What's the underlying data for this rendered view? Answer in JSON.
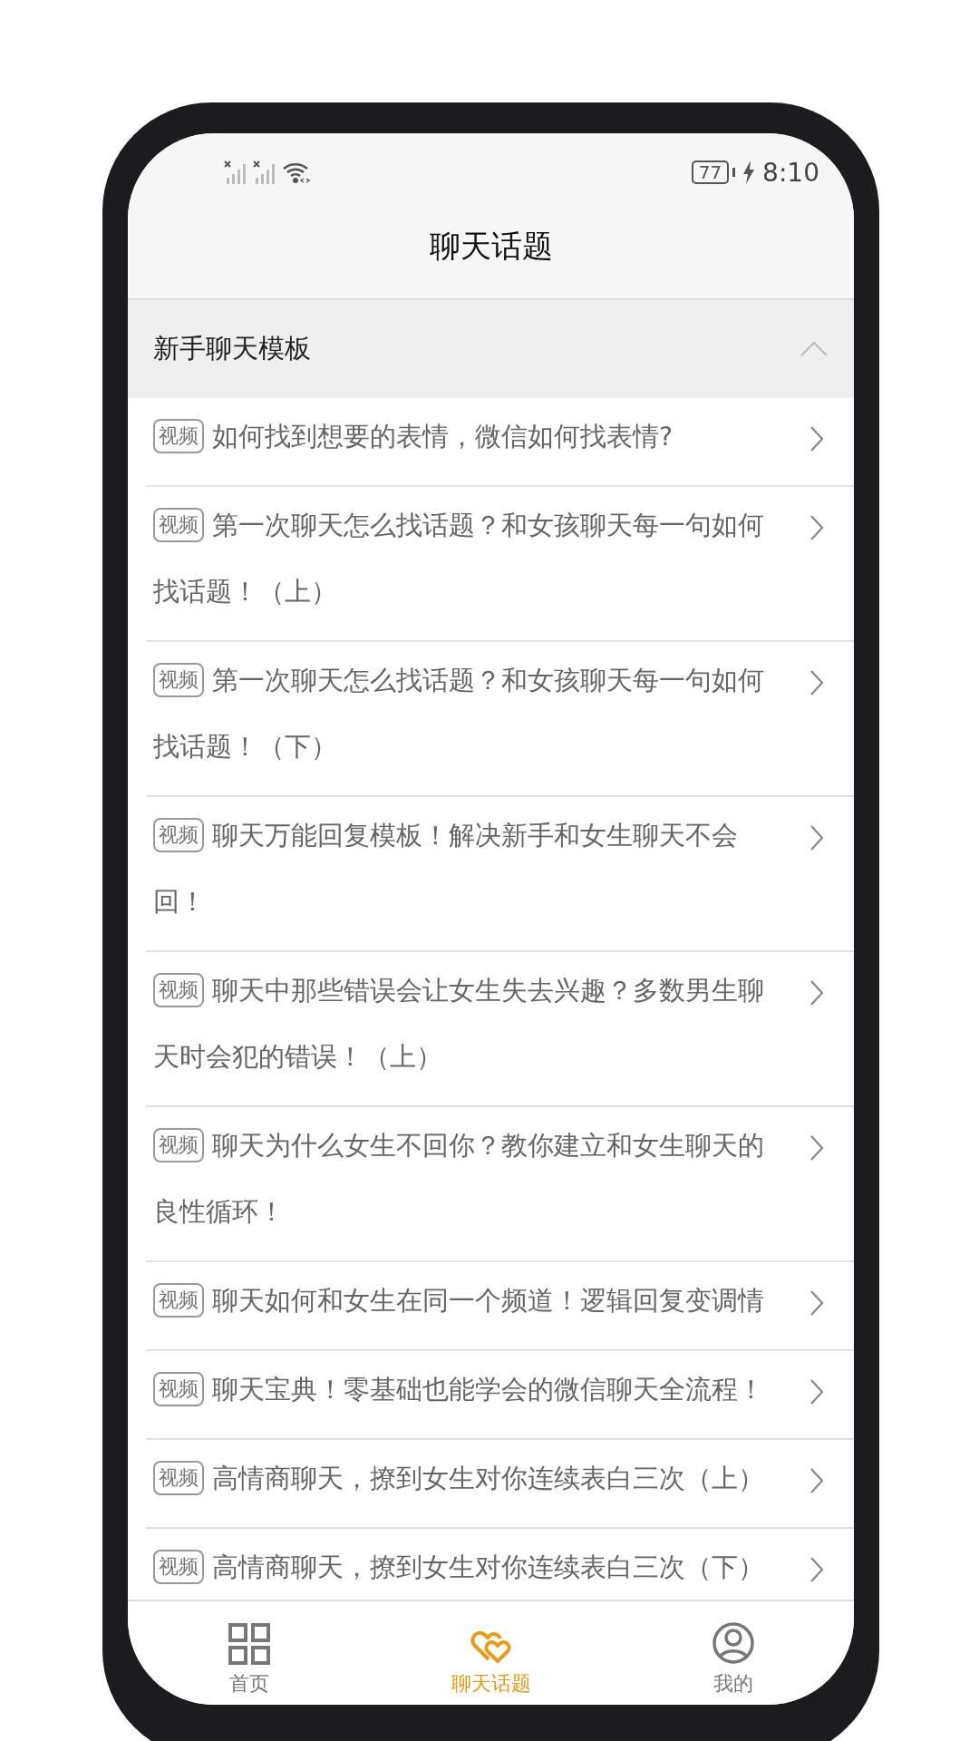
{
  "status_bar": {
    "battery": "77",
    "time": "8:10"
  },
  "title": "聊天话题",
  "section": {
    "title": "新手聊天模板",
    "expanded": true
  },
  "items": [
    {
      "badge": "视频",
      "title": "如何找到想要的表情，微信如何找表情?"
    },
    {
      "badge": "视频",
      "title": "第一次聊天怎么找话题？和女孩聊天每一句如何找话题！（上）"
    },
    {
      "badge": "视频",
      "title": "第一次聊天怎么找话题？和女孩聊天每一句如何找话题！（下）"
    },
    {
      "badge": "视频",
      "title": "聊天万能回复模板！解决新手和女生聊天不会回！"
    },
    {
      "badge": "视频",
      "title": "聊天中那些错误会让女生失去兴趣？多数男生聊天时会犯的错误！（上）"
    },
    {
      "badge": "视频",
      "title": "聊天为什么女生不回你？教你建立和女生聊天的良性循环！"
    },
    {
      "badge": "视频",
      "title": "聊天如何和女生在同一个频道！逻辑回复变调情"
    },
    {
      "badge": "视频",
      "title": "聊天宝典！零基础也能学会的微信聊天全流程！"
    },
    {
      "badge": "视频",
      "title": "高情商聊天，撩到女生对你连续表白三次（上）"
    },
    {
      "badge": "视频",
      "title": "高情商聊天，撩到女生对你连续表白三次（下）"
    }
  ],
  "tab_bar": [
    {
      "label": "首页",
      "selected": false
    },
    {
      "label": "聊天话题",
      "selected": true
    },
    {
      "label": "我的",
      "selected": false
    }
  ]
}
